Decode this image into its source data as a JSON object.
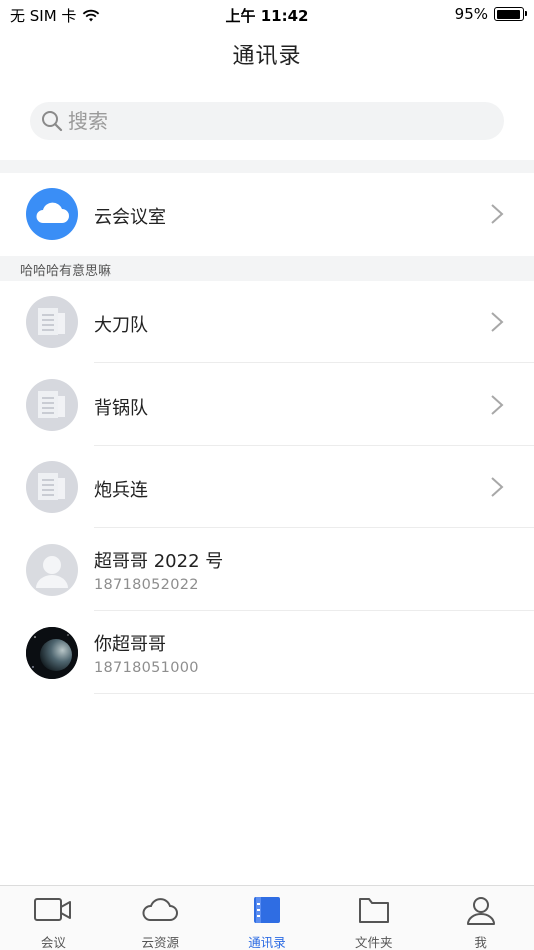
{
  "status_bar": {
    "carrier": "无 SIM 卡",
    "time": "上午 11:42",
    "battery_percent": "95%",
    "battery_level": 0.95
  },
  "header": {
    "title": "通讯录"
  },
  "search": {
    "placeholder": "搜索",
    "value": ""
  },
  "cloud_room": {
    "label": "云会议室",
    "icon": "cloud-icon",
    "color": "#3a8ef6"
  },
  "section": {
    "title": "哈哈哈有意思嘛"
  },
  "groups": [
    {
      "name": "大刀队",
      "icon": "group-document-icon"
    },
    {
      "name": "背锅队",
      "icon": "group-document-icon"
    },
    {
      "name": "炮兵连",
      "icon": "group-document-icon"
    }
  ],
  "contacts": [
    {
      "name": "超哥哥 2022 号",
      "phone": "18718052022",
      "avatar": "default-person-avatar"
    },
    {
      "name": "你超哥哥",
      "phone": "18718051000",
      "avatar": "planet-photo-avatar"
    }
  ],
  "tabbar": {
    "active_color": "#2f6de3",
    "items": [
      {
        "label": "会议",
        "icon": "video-camera-icon"
      },
      {
        "label": "云资源",
        "icon": "cloud-outline-icon"
      },
      {
        "label": "通讯录",
        "icon": "address-book-icon"
      },
      {
        "label": "文件夹",
        "icon": "folder-icon"
      },
      {
        "label": "我",
        "icon": "person-icon"
      }
    ]
  }
}
